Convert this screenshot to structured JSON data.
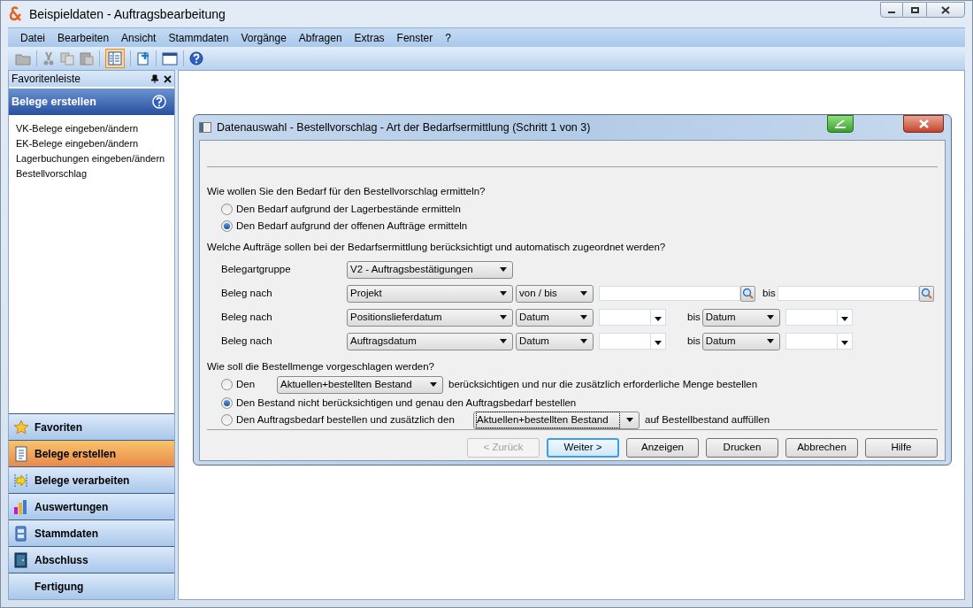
{
  "window": {
    "title": "Beispieldaten - Auftragsbearbeitung"
  },
  "menu": [
    "Datei",
    "Bearbeiten",
    "Ansicht",
    "Stammdaten",
    "Vorgänge",
    "Abfragen",
    "Extras",
    "Fenster",
    "?"
  ],
  "sidebar": {
    "title": "Favoritenleiste",
    "section": {
      "title": "Belege erstellen"
    },
    "items": [
      "VK-Belege eingeben/ändern",
      "EK-Belege eingeben/ändern",
      "Lagerbuchungen eingeben/ändern",
      "Bestellvorschlag"
    ],
    "nav": [
      {
        "label": "Favoriten",
        "selected": false
      },
      {
        "label": "Belege erstellen",
        "selected": true
      },
      {
        "label": "Belege verarbeiten",
        "selected": false
      },
      {
        "label": "Auswertungen",
        "selected": false
      },
      {
        "label": "Stammdaten",
        "selected": false
      },
      {
        "label": "Abschluss",
        "selected": false
      },
      {
        "label": "Fertigung",
        "selected": false
      }
    ]
  },
  "dialog": {
    "title": "Datenauswahl - Bestellvorschlag - Art der Bedarfsermittlung (Schritt 1 von 3)",
    "question_1": "Wie wollen Sie den Bedarf für den Bestellvorschlag ermitteln?",
    "demand_options": [
      {
        "label": "Den Bedarf aufgrund der Lagerbestände ermitteln",
        "selected": false
      },
      {
        "label": "Den Bedarf aufgrund der offenen Aufträge ermitteln",
        "selected": true
      }
    ],
    "question_2": "Welche Aufträge sollen bei der Bedarfsermittlung berücksichtigt und automatisch zugeordnet werden?",
    "filters": [
      {
        "kind": "group",
        "label": "Belegartgruppe",
        "value": "V2 - Auftragsbestätigungen"
      },
      {
        "kind": "lookup",
        "label": "Beleg nach",
        "value": "Projekt",
        "mode": "von / bis",
        "to_label": "bis"
      },
      {
        "kind": "date",
        "label": "Beleg nach",
        "value": "Positionslieferdatum",
        "mode": "Datum",
        "to_label": "bis",
        "to_mode": "Datum"
      },
      {
        "kind": "date",
        "label": "Beleg nach",
        "value": "Auftragsdatum",
        "mode": "Datum",
        "to_label": "bis",
        "to_mode": "Datum"
      }
    ],
    "question_3": "Wie soll die Bestellmenge vorgeschlagen werden?",
    "quantity_options": [
      {
        "kind": "short_select",
        "prefix": "Den",
        "value": "Aktuellen+bestellten Bestand",
        "suffix": "berücksichtigen und nur die zusätzlich erforderliche Menge bestellen",
        "selected": false,
        "focused": false
      },
      {
        "kind": "plain",
        "label": "Den Bestand nicht berücksichtigen und genau den Auftragsbedarf bestellen",
        "selected": true
      },
      {
        "kind": "long_select",
        "prefix": "Den Auftragsbedarf bestellen und zusätzlich den",
        "value": "Aktuellen+bestellten Bestand",
        "suffix": "auf Bestellbestand auffüllen",
        "selected": false,
        "focused": true
      }
    ],
    "buttons": [
      {
        "label": "< Zurück",
        "disabled": true,
        "default": false
      },
      {
        "label": "Weiter >",
        "disabled": false,
        "default": true
      },
      {
        "label": "Anzeigen",
        "disabled": false,
        "default": false
      },
      {
        "label": "Drucken",
        "disabled": false,
        "default": false
      },
      {
        "label": "Abbrechen",
        "disabled": false,
        "default": false
      },
      {
        "label": "Hilfe",
        "disabled": false,
        "default": false
      }
    ]
  }
}
